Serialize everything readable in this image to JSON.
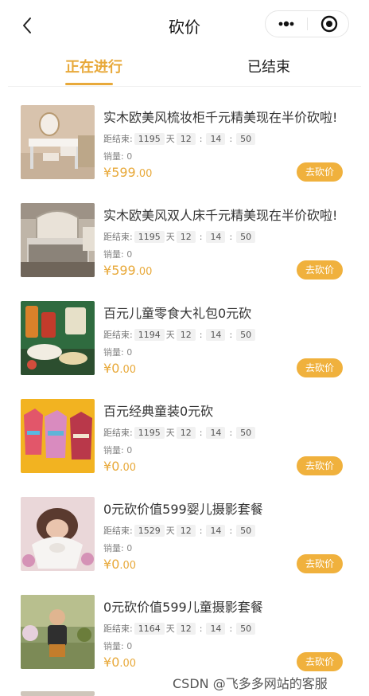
{
  "nav": {
    "title": "砍价"
  },
  "tabs": [
    {
      "label": "正在进行"
    },
    {
      "label": "已结束"
    }
  ],
  "labels": {
    "countdown_label": "距结束:",
    "day_unit": "天",
    "sales_label": "销量:",
    "currency": "¥",
    "button": "去砍价"
  },
  "items": [
    {
      "title": "实木欧美风梳妆柜千元精美现在半价砍啦!",
      "days": "1195",
      "h": "12",
      "m": "14",
      "s": "50",
      "sales": "0",
      "price_int": "599",
      "price_dec": ".00"
    },
    {
      "title": "实木欧美风双人床千元精美现在半价砍啦!",
      "days": "1195",
      "h": "12",
      "m": "14",
      "s": "50",
      "sales": "0",
      "price_int": "599",
      "price_dec": ".00"
    },
    {
      "title": "百元儿童零食大礼包0元砍",
      "days": "1194",
      "h": "12",
      "m": "14",
      "s": "50",
      "sales": "0",
      "price_int": "0",
      "price_dec": ".00"
    },
    {
      "title": "百元经典童装0元砍",
      "days": "1195",
      "h": "12",
      "m": "14",
      "s": "50",
      "sales": "0",
      "price_int": "0",
      "price_dec": ".00"
    },
    {
      "title": "0元砍价值599婴儿摄影套餐",
      "days": "1529",
      "h": "12",
      "m": "14",
      "s": "50",
      "sales": "0",
      "price_int": "0",
      "price_dec": ".00"
    },
    {
      "title": "0元砍价值599儿童摄影套餐",
      "days": "1164",
      "h": "12",
      "m": "14",
      "s": "50",
      "sales": "0",
      "price_int": "0",
      "price_dec": ".00"
    }
  ],
  "watermark": "CSDN @飞多多网站的客服",
  "colors": {
    "accent": "#E8A93A",
    "button": "#F0B13D"
  }
}
